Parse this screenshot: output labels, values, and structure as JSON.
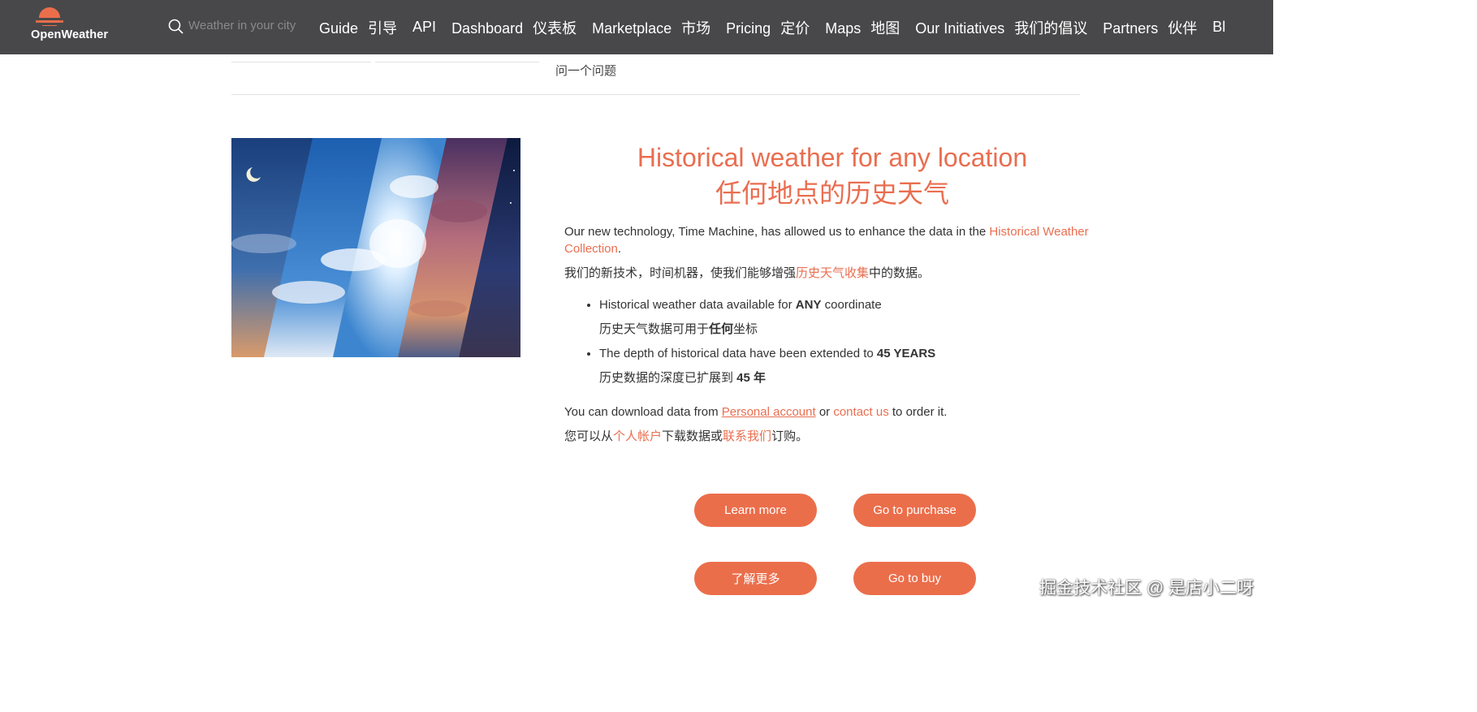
{
  "header": {
    "logo_text": "OpenWeather",
    "search_placeholder": "Weather in your city",
    "nav": [
      {
        "en": "Guide",
        "cn": "引导"
      },
      {
        "en": "API",
        "cn": ""
      },
      {
        "en": "Dashboard",
        "cn": "仪表板"
      },
      {
        "en": "Marketplace",
        "cn": "市场"
      },
      {
        "en": "Pricing",
        "cn": "定价"
      },
      {
        "en": "Maps",
        "cn": "地图"
      },
      {
        "en": "Our Initiatives",
        "cn": "我们的倡议"
      },
      {
        "en": "Partners",
        "cn": "伙伴"
      },
      {
        "en": "Bl",
        "cn": ""
      }
    ],
    "colors": {
      "bar": "#48484a",
      "accent": "#e96e50"
    }
  },
  "tabs": {
    "ask_question": "问一个问题"
  },
  "main": {
    "title_en": "Historical weather for any location",
    "title_cn": "任何地点的历史天气",
    "intro_en_before": "Our new technology, Time Machine, has allowed us to enhance the data in the ",
    "intro_en_link": "Historical Weather Collection",
    "intro_en_after": ".",
    "intro_cn_before": "我们的新技术，时间机器，使我们能够增强",
    "intro_cn_link": "历史天气收集",
    "intro_cn_after": "中的数据。",
    "bullet1_en_before": "Historical weather data available for ",
    "bullet1_en_bold": "ANY",
    "bullet1_en_after": " coordinate",
    "bullet1_cn_before": "历史天气数据可用于",
    "bullet1_cn_bold": "任何",
    "bullet1_cn_after": "坐标",
    "bullet2_en_before": "The depth of historical data have been extended to ",
    "bullet2_en_bold": "45 YEARS",
    "bullet2_cn_before": "历史数据的深度已扩展到 ",
    "bullet2_cn_bold": "45 年",
    "download_en_before": "You can download data from ",
    "download_en_link1": "Personal account",
    "download_en_mid": " or ",
    "download_en_link2": "contact us",
    "download_en_after": " to order it.",
    "download_cn_before": "您可以从",
    "download_cn_link1": "个人帐户",
    "download_cn_mid": "下载数据或",
    "download_cn_link2": "联系我们",
    "download_cn_after": "订购。"
  },
  "buttons": {
    "learn_more": "Learn more",
    "go_to_purchase": "Go to purchase",
    "learn_more_cn": "了解更多",
    "go_to_buy": "Go to buy"
  },
  "watermark": "掘金技术社区 @ 是店小二呀"
}
